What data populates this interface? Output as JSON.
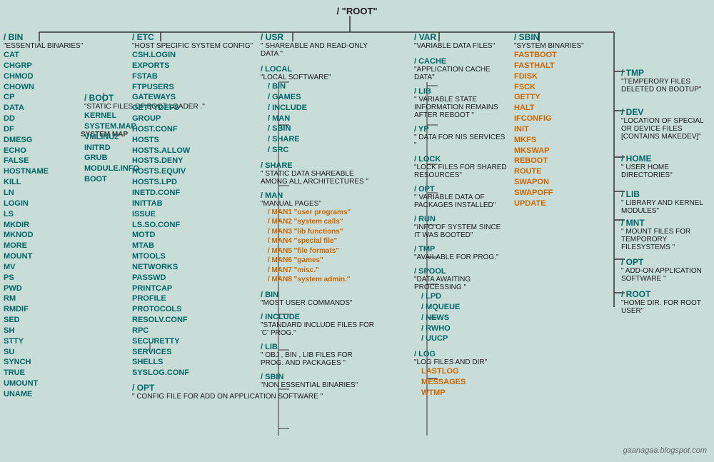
{
  "root": {
    "label": "/    \"ROOT\""
  },
  "bin": {
    "title": "/ BIN",
    "desc": "\"ESSENTIAL BINARIES\"",
    "items": [
      "CAT",
      "CHGRP",
      "CHMOD",
      "CHOWN",
      "CP",
      "DATA",
      "DD",
      "DF",
      "DMESG",
      "ECHO",
      "FALSE",
      "HOSTNAME",
      "KILL",
      "LN",
      "LOGIN",
      "LS",
      "MKDIR",
      "MKNOD",
      "MORE",
      "MOUNT",
      "MV",
      "PS",
      "PWD",
      "RM",
      "RMDIF",
      "SED",
      "SH",
      "STTY",
      "SU",
      "SYNCH",
      "TRUE",
      "UMOUNT",
      "UNAME"
    ]
  },
  "boot": {
    "title": "/ BOOT",
    "desc": "\"STATIC FILES OF BOOT LOADER .\"",
    "items": [
      "KERNEL",
      "SYSTEM.MAP",
      "VMLINUZ",
      "INITRD",
      "GRUB",
      "MODULE.INFO",
      "BOOT"
    ]
  },
  "etc": {
    "title": "/ ETC",
    "desc": "\"HOST SPECIFIC SYSTEM CONFIG\"",
    "items": [
      "CSH.LOGIN",
      "EXPORTS",
      "FSTAB",
      "FTPUSERS",
      "GATEWAYS",
      "GETTYDEFS",
      "GROUP",
      "HOST.CONF",
      "HOSTS",
      "HOSTS.ALLOW",
      "HOSTS.DENY",
      "HOSTS.EQUIV",
      "HOSTS.LPD",
      "INETD.CONF",
      "INITTAB",
      "ISSUE",
      "LS.SO.CONF",
      "MOTD",
      "MTAB",
      "MTOOLS",
      "NETWORKS",
      "PASSWD",
      "PRINTCAP",
      "PROFILE",
      "PROTOCOLS",
      "RESOLV.CONF",
      "RPC",
      "SECURETTY",
      "SERVICES",
      "SHELLS",
      "SYSLOG.CONF"
    ]
  },
  "etc_opt": {
    "title": "/ OPT",
    "desc": "\" CONFIG FILE FOR ADD ON APPLICATION SOFTWARE \""
  },
  "usr": {
    "title": "/ USR",
    "desc": "\" SHAREABLE AND READ-ONLY DATA \"",
    "local": {
      "title": "/ LOCAL",
      "desc": "\"LOCAL SOFTWARE\"",
      "items": [
        "/ BIN",
        "/ GAMES",
        "/ INCLUDE",
        "/ MAN",
        "/ SBIN",
        "/ SHARE",
        "/ SRC"
      ]
    },
    "share": {
      "title": "/ SHARE",
      "desc": "\" STATIC DATA SHAREABLE AMONG ALL ARCHITECTURES \""
    },
    "man": {
      "title": "/ MAN",
      "desc": "\"MANUAL PAGES\"",
      "items": [
        "/ MAN1 \"user programs\"",
        "/ MAN2 \"system calls\"",
        "/ MAN3 \"lib functions\"",
        "/ MAN4 \"special file\"",
        "/ MAN5 \"file formats\"",
        "/ MAN6 \"games\"",
        "/ MAN7 \"misc.\"",
        "/ MAN8 \"system admin.\""
      ]
    },
    "bin": {
      "title": "/ BIN",
      "desc": "\"MOST USER COMMANDS\""
    },
    "include": {
      "title": "/ INCLUDE",
      "desc": "\"STANDARD INCLUDE FILES FOR 'C' PROG.\""
    },
    "lib": {
      "title": "/ LIB",
      "desc": "\" OBJ , BIN , LIB FILES FOR PROG. AND PACKAGES \""
    },
    "sbin": {
      "title": "/ SBIN",
      "desc": "\"NON ESSENTIAL BINARIES\""
    }
  },
  "var": {
    "title": "/ VAR",
    "desc": "\"VARIABLE DATA FILES\"",
    "cache": {
      "title": "/ CACHE",
      "desc": "\"APPLICATION CACHE DATA\""
    },
    "lib": {
      "title": "/ LIB",
      "desc": "\" VARIABLE STATE INFORMATION REMAINS AFTER REBOOT \""
    },
    "yp": {
      "title": "/ YP",
      "desc": "\" DATA FOR NIS SERVICES \""
    },
    "lock": {
      "title": "/ LOCK",
      "desc": "\"LOCK FILES FOR SHARED RESOURCES\""
    },
    "opt": {
      "title": "/ OPT",
      "desc": "\" VARIABLE DATA OF PACKAGES INSTALLED\""
    },
    "run": {
      "title": "/ RUN",
      "desc": "\"INFO OF SYSTEM SINCE IT WAS BOOTED\""
    },
    "tmp": {
      "title": "/ TMP",
      "desc": "\"AVAILABLE FOR PROG.\""
    },
    "spool": {
      "title": "/ SPOOL",
      "desc": "\"DATA AWAITING PROCESSING \"",
      "items": [
        "/ LPD",
        "/ MQUEUE",
        "/ NEWS",
        "/ RWHO",
        "/ UUCP"
      ]
    },
    "log": {
      "title": "/ LOG",
      "desc": "\"LOG FILES AND DIR\"",
      "highlights": [
        "LASTLOG",
        "MESSAGES",
        "WTMP"
      ]
    }
  },
  "sbin": {
    "title": "/ SBIN",
    "desc": "\"SYSTEM BINARIES\"",
    "highlights": [
      "FASTBOOT",
      "FASTHALT",
      "FDISK",
      "FSCK",
      "GETTY",
      "HALT",
      "IFCONFIG",
      "INIT",
      "MKFS",
      "MKSWAP",
      "REBOOT",
      "ROUTE",
      "SWAPON",
      "SWAPOFF",
      "UPDATE"
    ]
  },
  "right": {
    "tmp": {
      "title": "/ TMP",
      "desc": "\"TEMPERORY FILES DELETED ON BOOTUP\""
    },
    "dev": {
      "title": "/ DEV",
      "desc": "\"LOCATION OF SPECIAL OR DEVICE FILES [CONTAINS MAKEDEV]\""
    },
    "home": {
      "title": "/ HOME",
      "desc": "\" USER HOME DIRECTORIES\""
    },
    "lib": {
      "title": "/ LIB",
      "desc": "\"  LIBRARY AND KERNEL MODULES\""
    },
    "mnt": {
      "title": "/ MNT",
      "desc": "\"  MOUNT FILES FOR TEMPORORY FILESYSTEMS \""
    },
    "opt": {
      "title": "/ OPT",
      "desc": "\" ADD-ON APPLICATION SOFTWARE \""
    },
    "root": {
      "title": "/ ROOT",
      "desc": "\"HOME DIR. FOR ROOT USER\""
    }
  },
  "watermark": "gaanagaa.blogspot.com",
  "system_map": "SYSTEM MAP"
}
